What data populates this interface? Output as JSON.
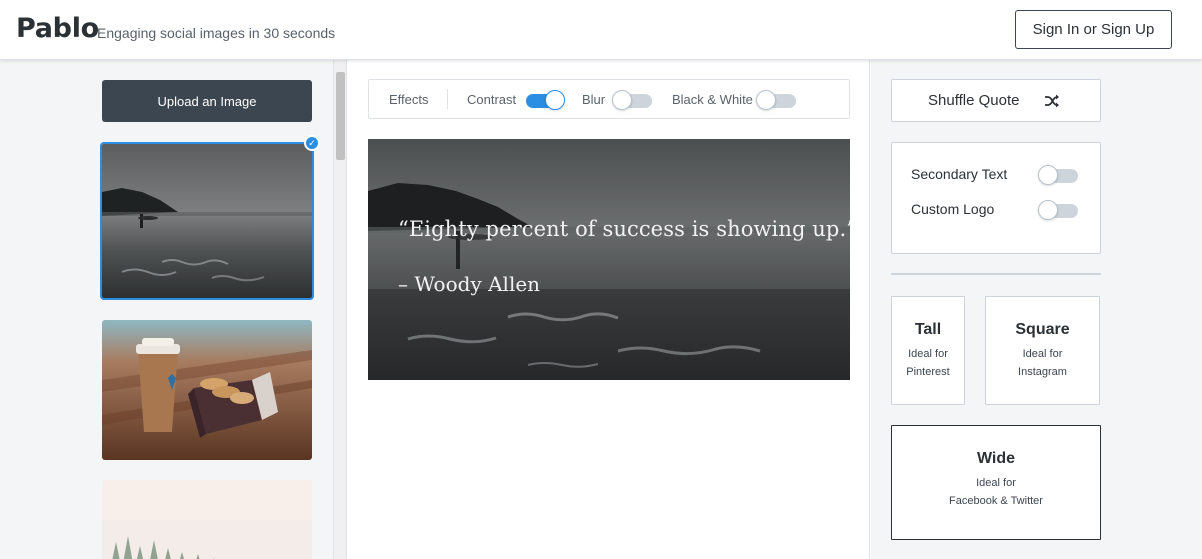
{
  "header": {
    "logo": "Pablo",
    "tagline": "Engaging social images in 30 seconds",
    "signin_label": "Sign In or Sign Up"
  },
  "sidebar": {
    "upload_label": "Upload an Image",
    "images": [
      {
        "name": "beach-surfer-image",
        "selected": true
      },
      {
        "name": "coffee-cookies-image",
        "selected": false
      },
      {
        "name": "misty-forest-image",
        "selected": false
      }
    ]
  },
  "effects": {
    "label": "Effects",
    "contrast": {
      "label": "Contrast",
      "on": true
    },
    "blur": {
      "label": "Blur",
      "on": false
    },
    "bw": {
      "label": "Black & White",
      "on": false
    }
  },
  "preview": {
    "quote": "“Eighty percent of success is showing up.”",
    "author": "– Woody Allen"
  },
  "right": {
    "shuffle_label": "Shuffle Quote",
    "shuffle_icon": "shuffle-icon",
    "secondary_text": {
      "label": "Secondary Text",
      "on": false
    },
    "custom_logo": {
      "label": "Custom Logo",
      "on": false
    },
    "sizes": {
      "tall": {
        "title": "Tall",
        "line1": "Ideal for",
        "line2": "Pinterest"
      },
      "square": {
        "title": "Square",
        "line1": "Ideal for",
        "line2": "Instagram"
      },
      "wide": {
        "title": "Wide",
        "line1": "Ideal for",
        "line2": "Facebook & Twitter",
        "selected": true
      }
    }
  },
  "colors": {
    "accent": "#2a8ee2",
    "dark": "#3c4650",
    "panel_bg": "#f4f5f6"
  }
}
